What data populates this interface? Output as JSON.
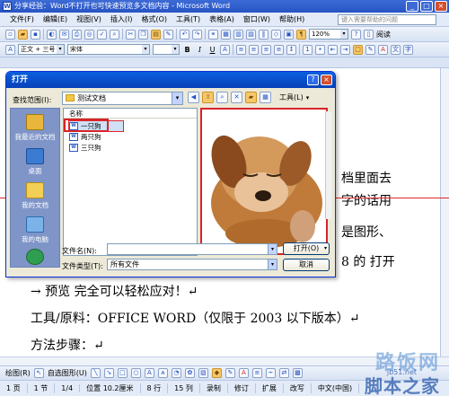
{
  "window": {
    "title": "分享经验：Word不打开也可快速预览多文档内容 - Microsoft Word"
  },
  "menu": [
    "文件(F)",
    "编辑(E)",
    "视图(V)",
    "插入(I)",
    "格式(O)",
    "工具(T)",
    "表格(A)",
    "窗口(W)",
    "帮助(H)"
  ],
  "help_placeholder": "键入需要帮助的问题",
  "toolbar": {
    "zoom": "120%",
    "style": "正文 + 三号",
    "font": "宋体",
    "read_label": "阅读"
  },
  "document": {
    "lines": [
      "档里面去",
      "字的话用",
      "是图形、",
      "8 的 打开",
      "→ 预览 完全可以轻松应对！↵",
      "工具/原料：OFFICE WORD（仅限于 2003 以下版本）↵",
      "方法步骤：↵"
    ]
  },
  "dialog": {
    "title": "打开",
    "look_in_label": "查找范围(I):",
    "look_in_value": "测试文档",
    "tools_label": "工具(L)",
    "places": [
      "我最近的文档",
      "桌面",
      "我的文档",
      "我的电脑"
    ],
    "column_name": "名称",
    "files": [
      "一只狗",
      "两只狗",
      "三只狗"
    ],
    "filename_label": "文件名(N):",
    "filename_value": "",
    "filetype_label": "文件类型(T):",
    "filetype_value": "所有文件",
    "open_button": "打开(O)",
    "cancel_button": "取消"
  },
  "drawing_bar": {
    "draw_label": "绘图(R)",
    "autoshape_label": "自选图形(U)"
  },
  "status": [
    "1 页",
    "1 节",
    "1/4",
    "位置 10.2厘米",
    "8 行",
    "15 列",
    "录制",
    "修订",
    "扩展",
    "改写",
    "中文(中国)"
  ],
  "watermark": {
    "line1": "路饭网",
    "line2": "脚本之家",
    "url": "jb51.net"
  }
}
